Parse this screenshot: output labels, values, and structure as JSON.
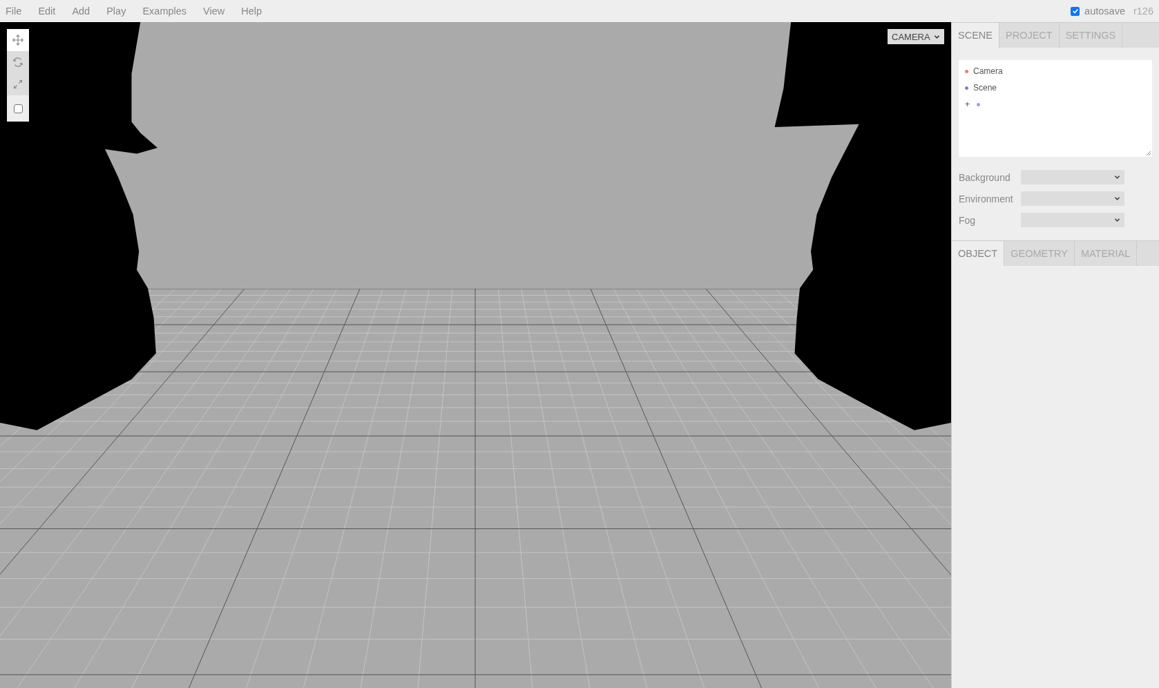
{
  "menubar": {
    "menus": [
      "File",
      "Edit",
      "Add",
      "Play",
      "Examples",
      "View",
      "Help"
    ],
    "autosave": {
      "label": "autosave",
      "checked": true
    },
    "version": "r126"
  },
  "viewport": {
    "toolbar": [
      {
        "kind": "move",
        "selected": true
      },
      {
        "kind": "rotate",
        "selected": false
      },
      {
        "kind": "scale",
        "selected": false
      },
      {
        "kind": "checkbox",
        "checked": false
      }
    ],
    "camera_select": "CAMERA"
  },
  "sidebar": {
    "tabs": [
      {
        "label": "SCENE",
        "selected": true
      },
      {
        "label": "PROJECT",
        "selected": false
      },
      {
        "label": "SETTINGS",
        "selected": false
      }
    ],
    "outliner": [
      {
        "label": "Camera",
        "color": "#e08080"
      },
      {
        "label": "Scene",
        "color": "#8080d8"
      },
      {
        "toggle": "+",
        "color": "#a0a0f0"
      }
    ],
    "properties": [
      {
        "label": "Background"
      },
      {
        "label": "Environment"
      },
      {
        "label": "Fog"
      }
    ],
    "object_tabs": [
      {
        "label": "OBJECT",
        "selected": true
      },
      {
        "label": "GEOMETRY",
        "selected": false
      },
      {
        "label": "MATERIAL",
        "selected": false
      }
    ]
  }
}
